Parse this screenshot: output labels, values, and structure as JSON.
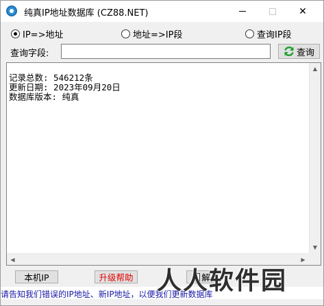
{
  "window": {
    "title": "纯真IP地址数据库  (CZ88.NET)",
    "close_glyph": "✕"
  },
  "mode_options": [
    {
      "label": "IP=>地址",
      "selected": true
    },
    {
      "label": "地址=>IP段",
      "selected": false
    },
    {
      "label": "查询IP段",
      "selected": false
    }
  ],
  "query": {
    "label": "查询字段:",
    "value": "",
    "button_label": "查询"
  },
  "result": {
    "lines": [
      "记录总数: 546212条",
      "更新日期: 2023年09月20日",
      "数据库版本: 纯真"
    ]
  },
  "buttons": {
    "local_ip": "本机IP",
    "upgrade_help": "升级帮助",
    "decode": "解"
  },
  "status": {
    "marquee": "请告知我们错误的IP地址、新IP地址，以便我们更新数据库"
  },
  "watermark": "人人软件园",
  "colors": {
    "help_text": "#e00000",
    "marquee_text": "#1a1aa6",
    "refresh_icon": "#1e9e2e",
    "app_icon": "#2f8fd8"
  }
}
